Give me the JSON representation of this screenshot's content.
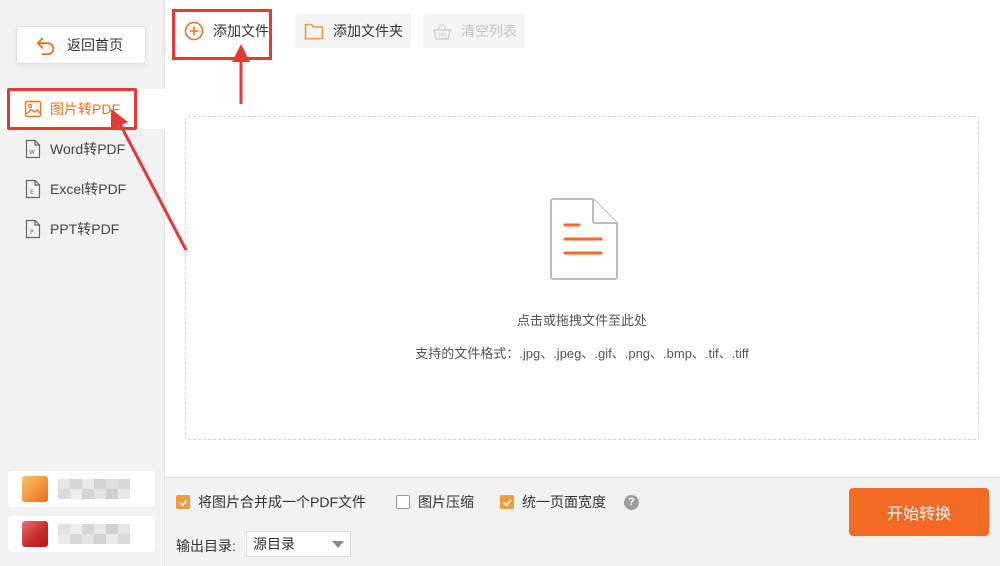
{
  "sidebar": {
    "back_label": "返回首页",
    "items": [
      {
        "label": "图片转PDF",
        "icon": "image-icon",
        "active": true
      },
      {
        "label": "Word转PDF",
        "icon": "word-doc-icon",
        "active": false
      },
      {
        "label": "Excel转PDF",
        "icon": "excel-doc-icon",
        "active": false
      },
      {
        "label": "PPT转PDF",
        "icon": "ppt-doc-icon",
        "active": false
      }
    ]
  },
  "toolbar": {
    "add_file_label": "添加文件",
    "add_folder_label": "添加文件夹",
    "clear_list_label": "清空列表"
  },
  "dropzone": {
    "hint": "点击或拖拽文件至此处",
    "formats": "支持的文件格式：.jpg、.jpeg、.gif、.png、.bmp、.tif、.tiff"
  },
  "options": {
    "merge_label": "将图片合并成一个PDF文件",
    "merge_checked": true,
    "compress_label": "图片压缩",
    "compress_checked": false,
    "uniform_width_label": "统一页面宽度",
    "uniform_width_checked": true,
    "help_icon": "?"
  },
  "output": {
    "label": "输出目录:",
    "selected": "源目录"
  },
  "start_label": "开始转换",
  "colors": {
    "accent": "#f26a24",
    "active_text": "#f0701e",
    "annotation_red": "#e53935",
    "checkbox": "#f29a3c"
  }
}
